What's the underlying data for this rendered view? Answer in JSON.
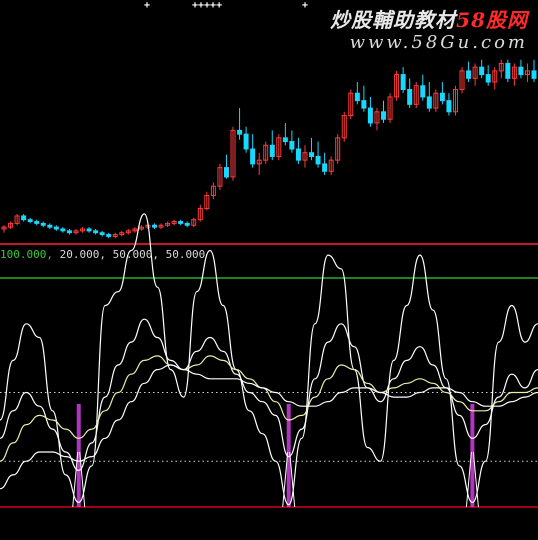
{
  "watermark": {
    "prefix": "炒股輔助教材",
    "brand": "58股网",
    "url": "www.58Gu.com"
  },
  "top_markers": [
    "+",
    "+++++",
    "+"
  ],
  "indicator_params": {
    "first": "100.000,",
    "rest": "20.000, 50.000, 50.000"
  },
  "colors": {
    "background": "#000000",
    "up": "#ff3a3a",
    "down": "#18d8ff",
    "line": "#ffffff",
    "ma_line": "#e8f0a8",
    "signal": "#d040e0",
    "upper_band": "#30d030",
    "lower_band": "#ff0020",
    "divider": "#ff2030",
    "dotted_level": "#cfcfcf"
  },
  "chart_data": [
    {
      "type": "candlestick",
      "title": "",
      "xlabel": "",
      "ylabel": "",
      "ylim": [
        0,
        100
      ],
      "grid": false,
      "legend": "none",
      "candles": [
        [
          7,
          9,
          5,
          8
        ],
        [
          8,
          11,
          7,
          10
        ],
        [
          10,
          15,
          9,
          14
        ],
        [
          14,
          15,
          11,
          12
        ],
        [
          12,
          13,
          10,
          11
        ],
        [
          11,
          12,
          9,
          10
        ],
        [
          10,
          11,
          8,
          9
        ],
        [
          9,
          10,
          7,
          8
        ],
        [
          8,
          9,
          6,
          7
        ],
        [
          7,
          8,
          5,
          6
        ],
        [
          6,
          7,
          4,
          5
        ],
        [
          5,
          7,
          4,
          6
        ],
        [
          6,
          8,
          5,
          7
        ],
        [
          7,
          8,
          5,
          6
        ],
        [
          6,
          7,
          4,
          5
        ],
        [
          5,
          6,
          3,
          4
        ],
        [
          4,
          5,
          2,
          3
        ],
        [
          3,
          5,
          2,
          4
        ],
        [
          4,
          6,
          3,
          5
        ],
        [
          5,
          7,
          4,
          6
        ],
        [
          6,
          8,
          5,
          7
        ],
        [
          7,
          9,
          6,
          8
        ],
        [
          8,
          10,
          7,
          9
        ],
        [
          9,
          10,
          7,
          8
        ],
        [
          8,
          10,
          7,
          9
        ],
        [
          9,
          11,
          8,
          10
        ],
        [
          10,
          12,
          9,
          11
        ],
        [
          11,
          12,
          9,
          10
        ],
        [
          10,
          11,
          8,
          9
        ],
        [
          9,
          13,
          8,
          12
        ],
        [
          12,
          20,
          11,
          18
        ],
        [
          18,
          27,
          17,
          25
        ],
        [
          25,
          32,
          23,
          30
        ],
        [
          30,
          42,
          28,
          40
        ],
        [
          40,
          47,
          34,
          35
        ],
        [
          35,
          62,
          33,
          60
        ],
        [
          60,
          72,
          55,
          58
        ],
        [
          58,
          62,
          48,
          50
        ],
        [
          50,
          58,
          40,
          42
        ],
        [
          42,
          48,
          36,
          44
        ],
        [
          44,
          54,
          42,
          52
        ],
        [
          52,
          60,
          44,
          46
        ],
        [
          46,
          58,
          44,
          56
        ],
        [
          56,
          64,
          52,
          54
        ],
        [
          54,
          60,
          48,
          50
        ],
        [
          50,
          56,
          42,
          44
        ],
        [
          44,
          52,
          40,
          48
        ],
        [
          48,
          56,
          44,
          46
        ],
        [
          46,
          54,
          40,
          42
        ],
        [
          42,
          48,
          36,
          38
        ],
        [
          38,
          46,
          36,
          44
        ],
        [
          44,
          58,
          42,
          56
        ],
        [
          56,
          70,
          54,
          68
        ],
        [
          68,
          82,
          66,
          80
        ],
        [
          80,
          86,
          74,
          76
        ],
        [
          76,
          84,
          70,
          72
        ],
        [
          72,
          78,
          62,
          64
        ],
        [
          64,
          72,
          60,
          70
        ],
        [
          70,
          76,
          64,
          66
        ],
        [
          66,
          80,
          64,
          78
        ],
        [
          78,
          92,
          76,
          90
        ],
        [
          90,
          94,
          80,
          82
        ],
        [
          82,
          88,
          72,
          74
        ],
        [
          74,
          86,
          72,
          84
        ],
        [
          84,
          90,
          76,
          78
        ],
        [
          78,
          86,
          70,
          72
        ],
        [
          72,
          82,
          70,
          80
        ],
        [
          80,
          86,
          74,
          76
        ],
        [
          76,
          80,
          68,
          70
        ],
        [
          70,
          84,
          68,
          82
        ],
        [
          82,
          94,
          80,
          92
        ],
        [
          92,
          97,
          86,
          88
        ],
        [
          88,
          96,
          84,
          94
        ],
        [
          94,
          98,
          88,
          90
        ],
        [
          90,
          95,
          84,
          86
        ],
        [
          86,
          94,
          82,
          92
        ],
        [
          92,
          98,
          88,
          96
        ],
        [
          96,
          98,
          86,
          88
        ],
        [
          88,
          96,
          84,
          94
        ],
        [
          94,
          98,
          88,
          90
        ],
        [
          90,
          96,
          86,
          92
        ],
        [
          92,
          98,
          86,
          88
        ]
      ]
    },
    {
      "type": "line",
      "title": "",
      "xlabel": "",
      "ylabel": "",
      "ylim": [
        0,
        100
      ],
      "grid": false,
      "legend": "none",
      "levels": [
        {
          "value": 100,
          "style": "solid",
          "color": "#30d030"
        },
        {
          "value": 50,
          "style": "dotted",
          "color": "#cfcfcf"
        },
        {
          "value": 20,
          "style": "dotted",
          "color": "#cfcfcf"
        },
        {
          "value": 0,
          "style": "solid",
          "color": "#ff0020"
        }
      ],
      "series": [
        {
          "values": [
            38,
            64,
            80,
            74,
            42,
            14,
            2,
            18,
            88,
            94,
            112,
            128,
            96,
            60,
            48,
            94,
            112,
            88,
            60,
            42,
            32,
            20,
            1,
            30,
            80,
            110,
            104,
            60,
            26,
            20,
            64,
            88,
            110,
            86,
            56,
            18,
            2,
            20,
            72,
            88,
            72,
            80
          ]
        },
        {
          "values": [
            30,
            42,
            50,
            44,
            34,
            24,
            16,
            28,
            48,
            62,
            72,
            82,
            74,
            64,
            60,
            68,
            74,
            68,
            58,
            50,
            46,
            40,
            22,
            34,
            56,
            72,
            80,
            70,
            52,
            46,
            56,
            64,
            70,
            62,
            52,
            40,
            30,
            36,
            48,
            58,
            52,
            60
          ]
        },
        {
          "values": [
            20,
            28,
            36,
            40,
            38,
            34,
            30,
            34,
            42,
            50,
            58,
            64,
            66,
            62,
            60,
            62,
            66,
            64,
            60,
            56,
            52,
            46,
            38,
            40,
            48,
            56,
            62,
            60,
            54,
            50,
            52,
            54,
            56,
            54,
            50,
            46,
            42,
            42,
            46,
            50,
            50,
            52
          ]
        },
        {
          "values": [
            8,
            14,
            20,
            24,
            24,
            22,
            20,
            22,
            30,
            38,
            46,
            54,
            60,
            62,
            60,
            58,
            56,
            56,
            56,
            54,
            52,
            50,
            46,
            44,
            44,
            46,
            50,
            52,
            52,
            50,
            48,
            48,
            50,
            52,
            52,
            50,
            46,
            44,
            44,
            46,
            48,
            50
          ]
        }
      ],
      "signals": [
        {
          "x": 6,
          "values": [
            0,
            12,
            24,
            45
          ]
        },
        {
          "x": 22,
          "values": [
            0,
            12,
            24,
            45
          ]
        },
        {
          "x": 36,
          "values": [
            0,
            12,
            24,
            45
          ]
        }
      ]
    }
  ]
}
